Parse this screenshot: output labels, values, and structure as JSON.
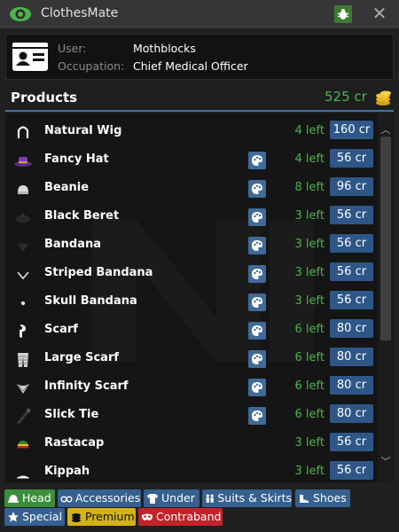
{
  "window": {
    "title": "ClothesMate",
    "close_glyph": "✕"
  },
  "user": {
    "user_label": "User:",
    "user_value": "Mothblocks",
    "occupation_label": "Occupation:",
    "occupation_value": "Chief Medical Officer"
  },
  "products": {
    "title": "Products",
    "balance": "525 cr"
  },
  "items": [
    {
      "name": "Natural Wig",
      "left": "4 left",
      "price": "160 cr",
      "paint": false,
      "icon": "wig-icon"
    },
    {
      "name": "Fancy Hat",
      "left": "4 left",
      "price": "56 cr",
      "paint": true,
      "icon": "fancy-hat-icon"
    },
    {
      "name": "Beanie",
      "left": "8 left",
      "price": "96 cr",
      "paint": true,
      "icon": "beanie-icon"
    },
    {
      "name": "Black Beret",
      "left": "3 left",
      "price": "56 cr",
      "paint": true,
      "icon": "beret-icon"
    },
    {
      "name": "Bandana",
      "left": "3 left",
      "price": "56 cr",
      "paint": true,
      "icon": "bandana-icon"
    },
    {
      "name": "Striped Bandana",
      "left": "3 left",
      "price": "56 cr",
      "paint": true,
      "icon": "striped-bandana-icon"
    },
    {
      "name": "Skull Bandana",
      "left": "3 left",
      "price": "56 cr",
      "paint": true,
      "icon": "skull-bandana-icon"
    },
    {
      "name": "Scarf",
      "left": "6 left",
      "price": "80 cr",
      "paint": true,
      "icon": "scarf-icon"
    },
    {
      "name": "Large Scarf",
      "left": "6 left",
      "price": "80 cr",
      "paint": true,
      "icon": "large-scarf-icon"
    },
    {
      "name": "Infinity Scarf",
      "left": "6 left",
      "price": "80 cr",
      "paint": true,
      "icon": "infinity-scarf-icon"
    },
    {
      "name": "Slick Tie",
      "left": "6 left",
      "price": "80 cr",
      "paint": true,
      "icon": "tie-icon"
    },
    {
      "name": "Rastacap",
      "left": "3 left",
      "price": "56 cr",
      "paint": false,
      "icon": "rastacap-icon"
    },
    {
      "name": "Kippah",
      "left": "3 left",
      "price": "56 cr",
      "paint": false,
      "icon": "kippah-icon"
    }
  ],
  "tabs": [
    {
      "label": "Head",
      "color": "green",
      "icon": "hat-icon"
    },
    {
      "label": "Accessories",
      "color": "blue",
      "icon": "glasses-icon"
    },
    {
      "label": "Under",
      "color": "blue",
      "icon": "shirt-icon"
    },
    {
      "label": "Suits & Skirts",
      "color": "blue",
      "icon": "people-icon"
    },
    {
      "label": "Shoes",
      "color": "blue",
      "icon": "shoe-icon"
    },
    {
      "label": "Special",
      "color": "blue",
      "icon": "star-icon"
    },
    {
      "label": "Premium",
      "color": "yellow",
      "icon": "coins-icon"
    },
    {
      "label": "Contraband",
      "color": "red",
      "icon": "mask-icon"
    }
  ],
  "colors": {
    "accent_green": "#4cb44a",
    "price_button": "#2e5788",
    "header_line": "#4572a8"
  }
}
